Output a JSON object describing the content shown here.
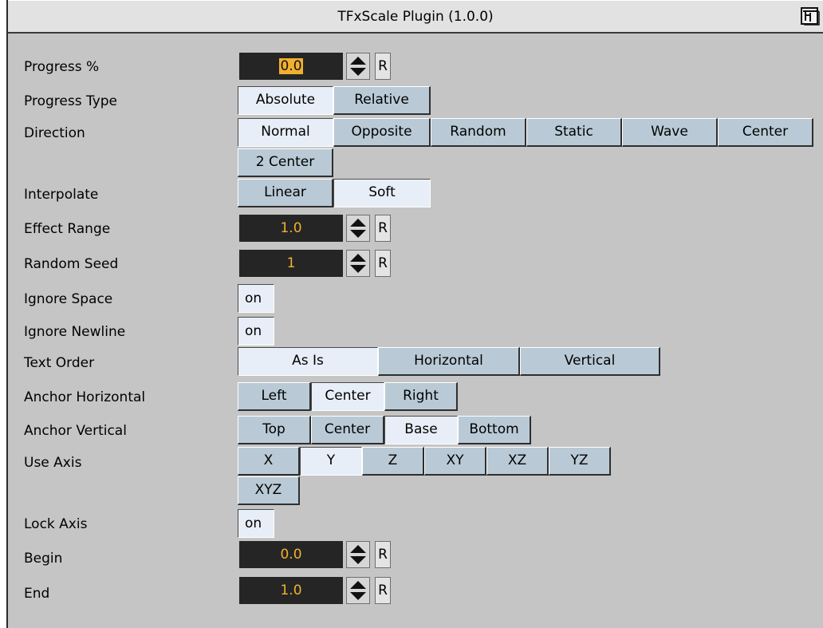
{
  "window": {
    "title": "TFxScale Plugin (1.0.0)",
    "help_icon": "help-book-icon"
  },
  "fields": {
    "progress": {
      "label": "Progress %",
      "value": "0.0",
      "reset": "R"
    },
    "progress_type": {
      "label": "Progress Type",
      "options": [
        "Absolute",
        "Relative"
      ],
      "selected": "Absolute"
    },
    "direction": {
      "label": "Direction",
      "options": [
        "Normal",
        "Opposite",
        "Random",
        "Static",
        "Wave",
        "Center",
        "2 Center"
      ],
      "selected": "Normal"
    },
    "interpolate": {
      "label": "Interpolate",
      "options": [
        "Linear",
        "Soft"
      ],
      "selected": "Soft"
    },
    "effect_range": {
      "label": "Effect Range",
      "value": "1.0",
      "reset": "R"
    },
    "random_seed": {
      "label": "Random Seed",
      "value": "1",
      "reset": "R"
    },
    "ignore_space": {
      "label": "Ignore Space",
      "value": "on"
    },
    "ignore_newline": {
      "label": "Ignore Newline",
      "value": "on"
    },
    "text_order": {
      "label": "Text Order",
      "options": [
        "As Is",
        "Horizontal",
        "Vertical"
      ],
      "selected": "As Is"
    },
    "anchor_horizontal": {
      "label": "Anchor Horizontal",
      "options": [
        "Left",
        "Center",
        "Right"
      ],
      "selected": "Center"
    },
    "anchor_vertical": {
      "label": "Anchor Vertical",
      "options": [
        "Top",
        "Center",
        "Base",
        "Bottom"
      ],
      "selected": "Base"
    },
    "use_axis": {
      "label": "Use Axis",
      "options": [
        "X",
        "Y",
        "Z",
        "XY",
        "XZ",
        "YZ",
        "XYZ"
      ],
      "selected": "Y"
    },
    "lock_axis": {
      "label": "Lock Axis",
      "value": "on"
    },
    "begin": {
      "label": "Begin",
      "value": "0.0",
      "reset": "R"
    },
    "end": {
      "label": "End",
      "value": "1.0",
      "reset": "R"
    }
  },
  "colors": {
    "panel": "#c5c5c5",
    "button": "#b9cad6",
    "button_selected": "#e8eef7",
    "field_bg": "#252525",
    "field_text": "#f0b030"
  }
}
